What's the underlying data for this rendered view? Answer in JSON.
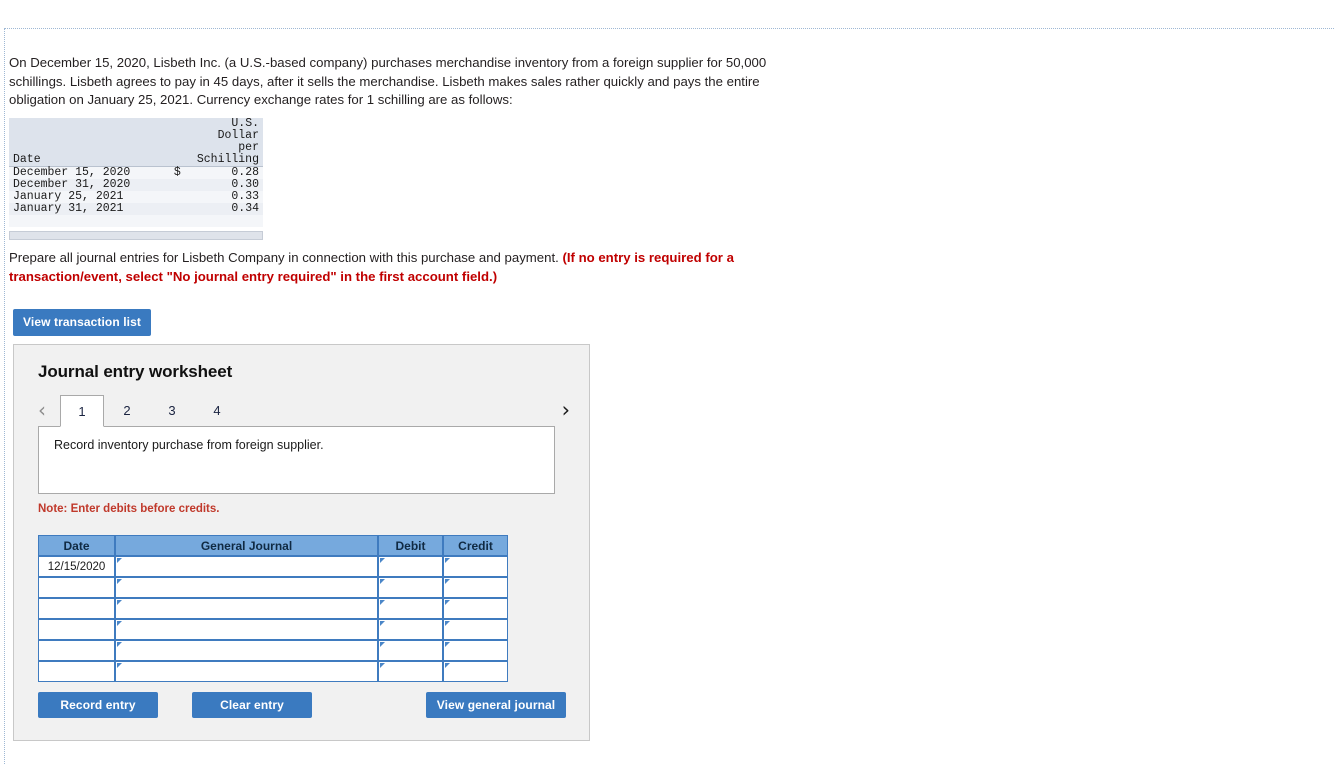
{
  "problem": {
    "statement": "On December 15, 2020, Lisbeth Inc. (a U.S.-based company) purchases merchandise inventory from a foreign supplier for 50,000 schillings. Lisbeth agrees to pay in 45 days, after it sells the merchandise. Lisbeth makes sales rather quickly and pays the entire obligation on January 25, 2021. Currency exchange rates for 1 schilling are as follows:",
    "instruction_plain": "Prepare all journal entries for Lisbeth Company in connection with this purchase and payment. ",
    "instruction_bold": "(If no entry is required for a transaction/event, select \"No journal entry required\" in the first account field.)"
  },
  "rate_table": {
    "header_line1": "U.S.",
    "header_line2": "Dollar",
    "header_line3": "per",
    "header_date": "Date",
    "header_unit": "Schilling",
    "rows": [
      {
        "date": "December 15, 2020",
        "currency": "$",
        "rate": "0.28"
      },
      {
        "date": "December 31, 2020",
        "currency": "",
        "rate": "0.30"
      },
      {
        "date": "January 25, 2021",
        "currency": "",
        "rate": "0.33"
      },
      {
        "date": "January 31, 2021",
        "currency": "",
        "rate": "0.34"
      }
    ]
  },
  "buttons": {
    "view_transaction_list": "View transaction list",
    "record_entry": "Record entry",
    "clear_entry": "Clear entry",
    "view_general_journal": "View general journal"
  },
  "worksheet": {
    "title": "Journal entry worksheet",
    "tabs": [
      {
        "label": "1",
        "active": true
      },
      {
        "label": "2",
        "active": false
      },
      {
        "label": "3",
        "active": false
      },
      {
        "label": "4",
        "active": false
      }
    ],
    "prev_icon": "chevron-left-icon",
    "next_icon": "chevron-right-icon",
    "prev_glyph": "‹",
    "next_glyph": "›",
    "description": "Record inventory purchase from foreign supplier.",
    "note": "Note: Enter debits before credits."
  },
  "journal_table": {
    "columns": [
      "Date",
      "General Journal",
      "Debit",
      "Credit"
    ],
    "rows": [
      {
        "date": "12/15/2020",
        "general_journal": "",
        "debit": "",
        "credit": ""
      },
      {
        "date": "",
        "general_journal": "",
        "debit": "",
        "credit": ""
      },
      {
        "date": "",
        "general_journal": "",
        "debit": "",
        "credit": ""
      },
      {
        "date": "",
        "general_journal": "",
        "debit": "",
        "credit": ""
      },
      {
        "date": "",
        "general_journal": "",
        "debit": "",
        "credit": ""
      },
      {
        "date": "",
        "general_journal": "",
        "debit": "",
        "credit": ""
      }
    ]
  },
  "colors": {
    "accent_blue": "#3a7ac0",
    "table_header_blue": "#76a9dd",
    "table_border_blue": "#3f7bbf",
    "note_red": "#c0392b",
    "instruction_red": "#c00000",
    "panel_gray": "#f1f1f1"
  }
}
